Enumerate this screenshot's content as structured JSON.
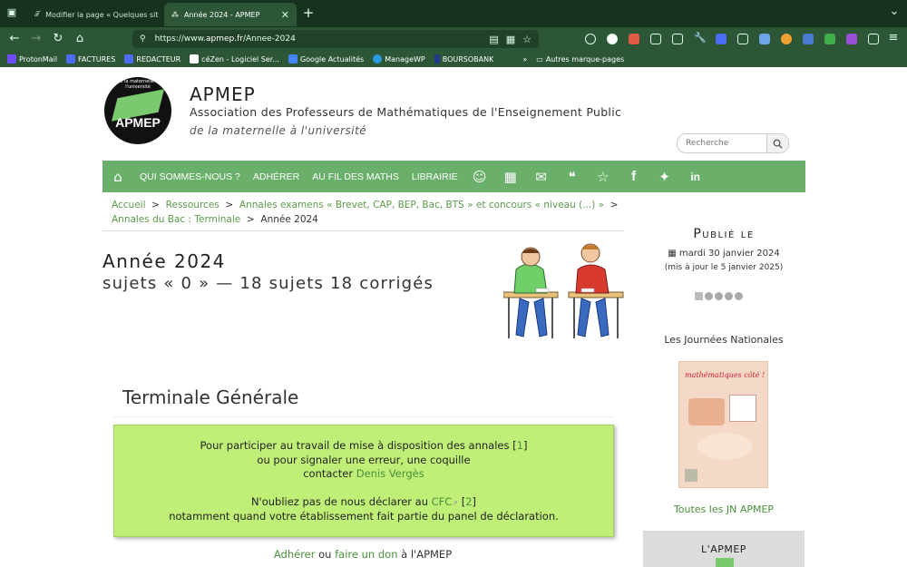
{
  "browser": {
    "tabs": [
      {
        "label": "Modifier la page « Quelques sit"
      },
      {
        "label": "Année 2024 - APMEP"
      }
    ],
    "url_scheme": "https://www.",
    "url_domain": "apmep.fr",
    "url_path": "/Annee-2024",
    "bookmarks": [
      {
        "label": "ProtonMail",
        "color": "#6d4aff"
      },
      {
        "label": "FACTURES",
        "color": "#4a6cf7"
      },
      {
        "label": "REDACTEUR",
        "color": "#4a6cf7"
      },
      {
        "label": "céZen - Logiciel Ser...",
        "color": "#ffffff"
      },
      {
        "label": "Google Actualités",
        "color": "#4285f4"
      },
      {
        "label": "ManageWP",
        "color": "#2b9be0"
      },
      {
        "label": "BOURSOBANK",
        "color": "#1b3a8a"
      }
    ],
    "other_bookmarks": "Autres marque-pages"
  },
  "site": {
    "logo_text": "APMEP",
    "logo_arc": "de la maternelle à l'université",
    "title": "APMEP",
    "subtitle": "Association des Professeurs de Mathématiques de l'Enseignement Public",
    "tagline": "de la maternelle à l'université",
    "search_placeholder": "Recherche"
  },
  "menu": {
    "items": [
      "QUI SOMMES-NOUS ?",
      "ADHÉRER",
      "AU FIL DES MATHS",
      "LIBRAIRIE"
    ]
  },
  "breadcrumb": {
    "items": [
      "Accueil",
      "Ressources",
      "Annales examens « Brevet, CAP, BEP, Bac, BTS » et concours « niveau (...) »",
      "Annales du Bac : Terminale"
    ],
    "current": "Année 2024"
  },
  "article": {
    "title": "Année 2024",
    "subtitle": "sujets « 0 » — 18 sujets 18 corrigés",
    "section": "Terminale Générale",
    "notice_l1a": "Pour participer au travail de mise à disposition des annales [",
    "notice_l1_link": "1",
    "notice_l1b": "]",
    "notice_l2": "ou pour signaler une erreur, une coquille",
    "notice_l3a": "contacter ",
    "notice_l3_link": "Denis Vergès",
    "notice_l4a": "N'oubliez pas de nous déclarer au ",
    "notice_l4_link": "CFC",
    "notice_l4b": " [",
    "notice_l4_link2": "2",
    "notice_l4c": "]",
    "notice_l5": "notamment quand votre établissement fait partie du panel de déclaration.",
    "adherer_link": "Adhérer",
    "adherer_or": " ou ",
    "don_link": "faire un don",
    "adherer_tail": " à l'APMEP"
  },
  "sidebar": {
    "published_title": "Publié le",
    "published_date": "mardi 30 janvier 2024",
    "updated": "(mis à jour le 5 janvier 2025)",
    "jn_title": "Les Journées Nationales",
    "poster_text": "mathématiques côté !",
    "all_jn": "Toutes les JN APMEP",
    "lapm_title": "L'APMEP"
  }
}
